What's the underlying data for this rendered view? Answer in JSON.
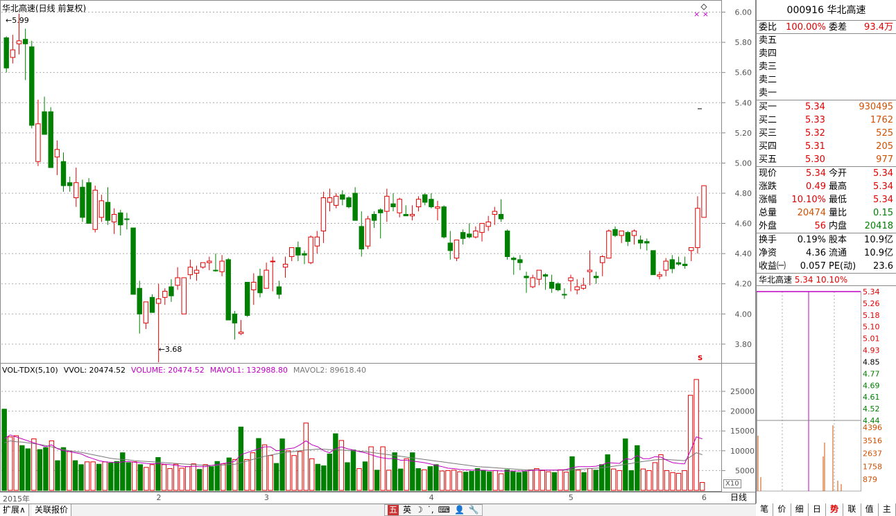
{
  "chart": {
    "title": "华北高速(日线 前复权)",
    "high_marker": "5.99",
    "low_marker": "3.68",
    "price_axis_ticks": [
      "6.00",
      "5.80",
      "5.60",
      "5.40",
      "5.20",
      "5.00",
      "4.80",
      "4.60",
      "4.40",
      "4.20",
      "4.00",
      "3.80"
    ],
    "vol_axis_ticks": [
      "25000",
      "20000",
      "15000",
      "10000",
      "5000"
    ],
    "vol_unit": "X10",
    "date_labels": [
      "2015年",
      "2",
      "3",
      "4",
      "5",
      "6"
    ],
    "period": "日线",
    "indicator": "VOL-TDX(5,10)",
    "vvol": "VVOL: 20474.52",
    "volume": "VOLUME: 20474.52",
    "mavol1": "MAVOL1: 132988.80",
    "mavol2": "MAVOL2: 89618.40",
    "corner_marks": "× ×",
    "s_mark": "S",
    "colors": {
      "up": "#e00000",
      "down": "#008000",
      "ma1": "#c000c0",
      "ma2": "#777777"
    }
  },
  "chart_data": {
    "type": "candlestick",
    "title": "华北高速(日线 前复权)",
    "ohlc": [
      [
        5.63,
        5.84,
        5.6,
        5.83,
        "down"
      ],
      [
        5.75,
        5.85,
        5.66,
        5.7,
        "up"
      ],
      [
        5.79,
        5.99,
        5.72,
        5.81,
        "up"
      ],
      [
        5.82,
        5.89,
        5.55,
        5.79,
        "down"
      ],
      [
        5.77,
        5.81,
        5.23,
        5.25,
        "down"
      ],
      [
        5.01,
        5.42,
        4.98,
        5.26,
        "up"
      ],
      [
        5.34,
        5.44,
        5.19,
        5.19,
        "down"
      ],
      [
        5.34,
        5.37,
        4.97,
        4.97,
        "down"
      ],
      [
        5.04,
        5.15,
        4.92,
        5.09,
        "up"
      ],
      [
        5.01,
        5.07,
        4.81,
        4.85,
        "down"
      ],
      [
        4.85,
        4.91,
        4.81,
        4.87,
        "down"
      ],
      [
        4.77,
        4.97,
        4.71,
        4.87,
        "up"
      ],
      [
        4.84,
        4.89,
        4.61,
        4.64,
        "down"
      ],
      [
        4.87,
        4.9,
        4.6,
        4.6,
        "down"
      ],
      [
        4.56,
        4.85,
        4.54,
        4.82,
        "up"
      ],
      [
        4.64,
        4.79,
        4.61,
        4.75,
        "up"
      ],
      [
        4.74,
        4.84,
        4.59,
        4.62,
        "down"
      ],
      [
        4.61,
        4.7,
        4.53,
        4.66,
        "up"
      ],
      [
        4.67,
        4.69,
        4.52,
        4.59,
        "down"
      ],
      [
        4.63,
        4.67,
        4.56,
        4.63,
        "down"
      ],
      [
        4.57,
        4.57,
        4.13,
        4.13,
        "down"
      ],
      [
        4.17,
        4.22,
        3.87,
        4.0,
        "down"
      ],
      [
        3.94,
        4.08,
        3.9,
        4.08,
        "up"
      ],
      [
        4.01,
        4.13,
        4.05,
        4.11,
        "down"
      ],
      [
        4.07,
        4.2,
        3.68,
        4.1,
        "up"
      ],
      [
        4.11,
        4.17,
        4.06,
        4.15,
        "up"
      ],
      [
        4.18,
        4.23,
        4.08,
        4.12,
        "down"
      ],
      [
        4.24,
        4.31,
        4.16,
        4.19,
        "up"
      ],
      [
        4.24,
        4.22,
        4.02,
        4.0,
        "up"
      ],
      [
        4.26,
        4.36,
        4.23,
        4.31,
        "up"
      ],
      [
        4.29,
        4.32,
        4.22,
        4.27,
        "up"
      ],
      [
        4.34,
        4.33,
        4.3,
        4.31,
        "up"
      ],
      [
        4.34,
        4.38,
        4.29,
        4.35,
        "up"
      ],
      [
        4.29,
        4.4,
        4.28,
        4.29,
        "down"
      ],
      [
        4.35,
        4.39,
        4.25,
        4.28,
        "up"
      ],
      [
        4.36,
        4.37,
        3.96,
        3.96,
        "down"
      ],
      [
        4.0,
        4.02,
        3.83,
        3.94,
        "down"
      ],
      [
        3.88,
        3.96,
        3.86,
        3.87,
        "up"
      ],
      [
        4.21,
        4.21,
        3.98,
        3.99,
        "down"
      ],
      [
        4.21,
        4.27,
        4.06,
        4.16,
        "up"
      ],
      [
        4.25,
        4.3,
        4.11,
        4.14,
        "down"
      ],
      [
        4.29,
        4.34,
        4.19,
        4.17,
        "up"
      ],
      [
        4.35,
        4.38,
        4.15,
        4.35,
        "up"
      ],
      [
        4.18,
        4.22,
        4.1,
        4.13,
        "down"
      ],
      [
        4.31,
        4.38,
        4.24,
        4.33,
        "up"
      ],
      [
        4.44,
        4.42,
        4.35,
        4.38,
        "up"
      ],
      [
        4.44,
        4.48,
        4.35,
        4.39,
        "down"
      ],
      [
        4.4,
        4.42,
        4.33,
        4.39,
        "down"
      ],
      [
        4.51,
        4.52,
        4.33,
        4.34,
        "up"
      ],
      [
        4.45,
        4.55,
        4.4,
        4.51,
        "up"
      ],
      [
        4.77,
        4.81,
        4.47,
        4.55,
        "up"
      ],
      [
        4.74,
        4.83,
        4.68,
        4.77,
        "up"
      ],
      [
        4.78,
        4.8,
        4.7,
        4.72,
        "up"
      ],
      [
        4.79,
        4.82,
        4.72,
        4.76,
        "down"
      ],
      [
        4.77,
        4.78,
        4.7,
        4.71,
        "down"
      ],
      [
        4.8,
        4.84,
        4.68,
        4.62,
        "down"
      ],
      [
        4.58,
        4.68,
        4.38,
        4.43,
        "down"
      ],
      [
        4.45,
        4.65,
        4.43,
        4.63,
        "up"
      ],
      [
        4.62,
        4.68,
        4.57,
        4.66,
        "down"
      ],
      [
        4.69,
        4.7,
        4.5,
        4.67,
        "down"
      ],
      [
        4.78,
        4.83,
        4.61,
        4.68,
        "up"
      ],
      [
        4.73,
        4.8,
        4.68,
        4.71,
        "down"
      ],
      [
        4.76,
        4.77,
        4.64,
        4.67,
        "up"
      ],
      [
        4.66,
        4.72,
        4.65,
        4.65,
        "down"
      ],
      [
        4.66,
        4.72,
        4.62,
        4.65,
        "up"
      ],
      [
        4.76,
        4.78,
        4.68,
        4.71,
        "up"
      ],
      [
        4.79,
        4.8,
        4.72,
        4.74,
        "down"
      ],
      [
        4.76,
        4.8,
        4.7,
        4.71,
        "down"
      ],
      [
        4.71,
        4.75,
        4.62,
        4.7,
        "up"
      ],
      [
        4.71,
        4.72,
        4.5,
        4.51,
        "down"
      ],
      [
        4.47,
        4.55,
        4.36,
        4.42,
        "down"
      ],
      [
        4.37,
        4.48,
        4.35,
        4.49,
        "up"
      ],
      [
        4.54,
        4.56,
        4.46,
        4.5,
        "down"
      ],
      [
        4.51,
        4.6,
        4.5,
        4.53,
        "down"
      ],
      [
        4.55,
        4.58,
        4.5,
        4.51,
        "up"
      ],
      [
        4.54,
        4.6,
        4.48,
        4.6,
        "up"
      ],
      [
        4.58,
        4.65,
        4.55,
        4.61,
        "up"
      ],
      [
        4.66,
        4.71,
        4.59,
        4.68,
        "up"
      ],
      [
        4.63,
        4.76,
        4.61,
        4.66,
        "down"
      ],
      [
        4.55,
        4.56,
        4.36,
        4.38,
        "down"
      ],
      [
        4.37,
        4.38,
        4.26,
        4.36,
        "down"
      ],
      [
        4.36,
        4.39,
        4.29,
        4.34,
        "down"
      ],
      [
        4.25,
        4.28,
        4.14,
        4.24,
        "down"
      ],
      [
        4.18,
        4.26,
        4.17,
        4.24,
        "up"
      ],
      [
        4.23,
        4.29,
        4.19,
        4.29,
        "up"
      ],
      [
        4.25,
        4.27,
        4.16,
        4.26,
        "down"
      ],
      [
        4.21,
        4.26,
        4.14,
        4.17,
        "down"
      ],
      [
        4.2,
        4.21,
        4.15,
        4.16,
        "down"
      ],
      [
        4.13,
        4.17,
        4.1,
        4.13,
        "down"
      ],
      [
        4.24,
        4.26,
        4.15,
        4.22,
        "up"
      ],
      [
        4.18,
        4.23,
        4.13,
        4.16,
        "up"
      ],
      [
        4.19,
        4.24,
        4.16,
        4.17,
        "up"
      ],
      [
        4.29,
        4.42,
        4.19,
        4.28,
        "up"
      ],
      [
        4.24,
        4.28,
        4.2,
        4.25,
        "down"
      ],
      [
        4.34,
        4.39,
        4.25,
        4.38,
        "up"
      ],
      [
        4.55,
        4.56,
        4.37,
        4.37,
        "up"
      ],
      [
        4.56,
        4.58,
        4.51,
        4.52,
        "down"
      ],
      [
        4.52,
        4.55,
        4.47,
        4.55,
        "up"
      ],
      [
        4.54,
        4.55,
        4.45,
        4.48,
        "down"
      ],
      [
        4.52,
        4.56,
        4.46,
        4.55,
        "up"
      ],
      [
        4.49,
        4.52,
        4.43,
        4.47,
        "down"
      ],
      [
        4.47,
        4.5,
        4.42,
        4.48,
        "down"
      ],
      [
        4.42,
        4.42,
        4.27,
        4.26,
        "down"
      ],
      [
        4.25,
        4.28,
        4.23,
        4.26,
        "up"
      ],
      [
        4.35,
        4.37,
        4.25,
        4.29,
        "up"
      ],
      [
        4.36,
        4.39,
        4.27,
        4.3,
        "down"
      ],
      [
        4.33,
        4.38,
        4.32,
        4.34,
        "down"
      ],
      [
        4.33,
        4.38,
        4.3,
        4.32,
        "down"
      ],
      [
        4.42,
        4.44,
        4.35,
        4.44,
        "up"
      ],
      [
        4.7,
        4.78,
        4.4,
        4.44,
        "up"
      ],
      [
        4.85,
        4.85,
        4.7,
        4.64,
        "up"
      ]
    ],
    "volume": [
      20500,
      13500,
      13800,
      11300,
      10500,
      13000,
      10300,
      10800,
      12500,
      7500,
      10800,
      9800,
      7500,
      6500,
      7200,
      7200,
      6600,
      7200,
      6900,
      7300,
      9500,
      7000,
      7200,
      6500,
      5800,
      6500,
      8300,
      6500,
      5500,
      6600,
      5600,
      6000,
      6700,
      5300,
      6500,
      6000,
      7300,
      6700,
      8200,
      7800,
      16000,
      7800,
      9500,
      13100,
      11500,
      8800,
      6800,
      13000,
      10000,
      8800,
      9800,
      17000,
      8000,
      6600,
      6200,
      9200,
      14300,
      12600,
      7000,
      10200,
      5500,
      7200,
      11000,
      5100,
      11000,
      5100,
      9500,
      5400,
      8000,
      9500,
      5500,
      5200,
      6000,
      6500,
      4900,
      5000,
      5100,
      4700,
      4600,
      4800,
      5500,
      5000,
      4700,
      5000,
      4200,
      5200,
      4700,
      4500,
      4700,
      5200,
      5500,
      5000,
      4700,
      4500,
      5200,
      4600,
      8500,
      5100,
      4500,
      5500,
      5100,
      6500,
      9000,
      5400,
      5000,
      13000,
      5000,
      11300,
      5400,
      5000,
      7000,
      9000,
      5000,
      4500,
      4300,
      5000,
      24000,
      28000,
      2000
    ],
    "mavol1": [
      13000,
      14000,
      13500,
      13000,
      12500,
      12000,
      11500,
      11000,
      11500,
      10500,
      10000,
      9800,
      9500,
      9200,
      8500,
      8000,
      7500,
      7200,
      7100,
      7000,
      7200,
      7300,
      7100,
      7000,
      6800,
      6700,
      6800,
      6600,
      6500,
      6300,
      6100,
      6000,
      6100,
      6000,
      6000,
      6300,
      6500,
      6800,
      7000,
      7400,
      9000,
      9500,
      10000,
      10500,
      11000,
      11000,
      10000,
      10200,
      10500,
      10700,
      11500,
      12500,
      11500,
      11000,
      10000,
      9500,
      10500,
      11000,
      10500,
      10200,
      9800,
      9500,
      9000,
      8500,
      8200,
      8000,
      8100,
      7600,
      7600,
      7400,
      7200,
      7000,
      6700,
      6300,
      6000,
      5600,
      5500,
      5300,
      5200,
      5100,
      5100,
      5100,
      5000,
      5000,
      4900,
      4900,
      4900,
      4900,
      4900,
      5000,
      5100,
      5100,
      5100,
      5100,
      5100,
      5300,
      5700,
      6000,
      6000,
      6000,
      6100,
      6400,
      7000,
      6900,
      6800,
      8000,
      7800,
      8800,
      8000,
      8000,
      8500,
      8400,
      7600,
      7000,
      6800,
      6700,
      10000,
      13500,
      13000
    ],
    "mavol2": [
      12000,
      12500,
      12300,
      12200,
      12000,
      11800,
      11600,
      11300,
      11000,
      10600,
      10300,
      10000,
      9800,
      9600,
      9300,
      9000,
      8700,
      8400,
      8100,
      7900,
      7800,
      7700,
      7500,
      7400,
      7300,
      7200,
      7100,
      7000,
      6900,
      6800,
      6700,
      6600,
      6500,
      6400,
      6300,
      6300,
      6300,
      6400,
      6500,
      6600,
      7000,
      7400,
      7800,
      8200,
      8600,
      8900,
      9200,
      9500,
      9700,
      9800,
      10000,
      10200,
      10300,
      10400,
      10400,
      10300,
      10300,
      10200,
      10100,
      10000,
      9900,
      9800,
      9600,
      9400,
      9200,
      9000,
      8800,
      8600,
      8400,
      8200,
      8000,
      7800,
      7600,
      7400,
      7200,
      7000,
      6800,
      6600,
      6400,
      6200,
      6000,
      5900,
      5800,
      5700,
      5600,
      5500,
      5400,
      5300,
      5200,
      5200,
      5200,
      5100,
      5100,
      5100,
      5100,
      5100,
      5200,
      5300,
      5400,
      5500,
      5600,
      5700,
      5900,
      6100,
      6300,
      6600,
      6800,
      7100,
      7300,
      7500,
      7700,
      7800,
      7800,
      7700,
      7600,
      7500,
      8500,
      9500,
      9000
    ],
    "ylim": [
      3.68,
      6.0
    ],
    "vol_ylim": [
      0,
      28000
    ]
  },
  "quote": {
    "code_name": "000916 华北高速",
    "weibi_label": "委比",
    "weibi": "100.00%",
    "weicha_label": "委差",
    "weicha": "93.4万",
    "asks": [
      {
        "label": "卖五"
      },
      {
        "label": "卖四"
      },
      {
        "label": "卖三"
      },
      {
        "label": "卖二"
      },
      {
        "label": "卖一"
      }
    ],
    "bids": [
      {
        "label": "买一",
        "price": "5.34",
        "vol": "930495"
      },
      {
        "label": "买二",
        "price": "5.33",
        "vol": "1762"
      },
      {
        "label": "买三",
        "price": "5.32",
        "vol": "525"
      },
      {
        "label": "买四",
        "price": "5.31",
        "vol": "205"
      },
      {
        "label": "买五",
        "price": "5.30",
        "vol": "977"
      }
    ],
    "stats": [
      {
        "l1": "现价",
        "v1": "5.34",
        "l2": "今开",
        "v2": "5.34"
      },
      {
        "l1": "涨跌",
        "v1": "0.49",
        "l2": "最高",
        "v2": "5.34"
      },
      {
        "l1": "涨幅",
        "v1": "10.10%",
        "l2": "最低",
        "v2": "5.34"
      },
      {
        "l1": "总量",
        "v1": "20474",
        "l2": "量比",
        "v2": "0.15"
      },
      {
        "l1": "外盘",
        "v1": "56",
        "l2": "内盘",
        "v2": "20418"
      }
    ],
    "fund": [
      {
        "l1": "换手",
        "v1": "0.19%",
        "l2": "股本",
        "v2": "10.9亿"
      },
      {
        "l1": "净资",
        "v1": "4.36",
        "l2": "流通",
        "v2": "10.9亿"
      },
      {
        "l1": "收益㈠",
        "v1": "0.057",
        "l2": "PE(动)",
        "v2": "23.6"
      }
    ]
  },
  "mini": {
    "name": "华北高速",
    "price": "5.34",
    "pct": "10.10%",
    "price_ticks": [
      "5.34",
      "5.26",
      "5.18",
      "5.10",
      "5.01",
      "4.93",
      "4.85",
      "4.77",
      "4.69",
      "4.61",
      "4.52",
      "4.44"
    ],
    "vol_ticks": [
      "4396",
      "3516",
      "2637",
      "1758",
      "879"
    ]
  },
  "bottom_tabs": [
    "扩展∧",
    "关联报价"
  ],
  "ime": [
    "五",
    "英",
    "☽",
    "˙,",
    "⌨",
    "👤",
    "🔧"
  ],
  "right_tabs": [
    "笔",
    "价",
    "细",
    "日",
    "势",
    "联",
    "值",
    "主"
  ]
}
